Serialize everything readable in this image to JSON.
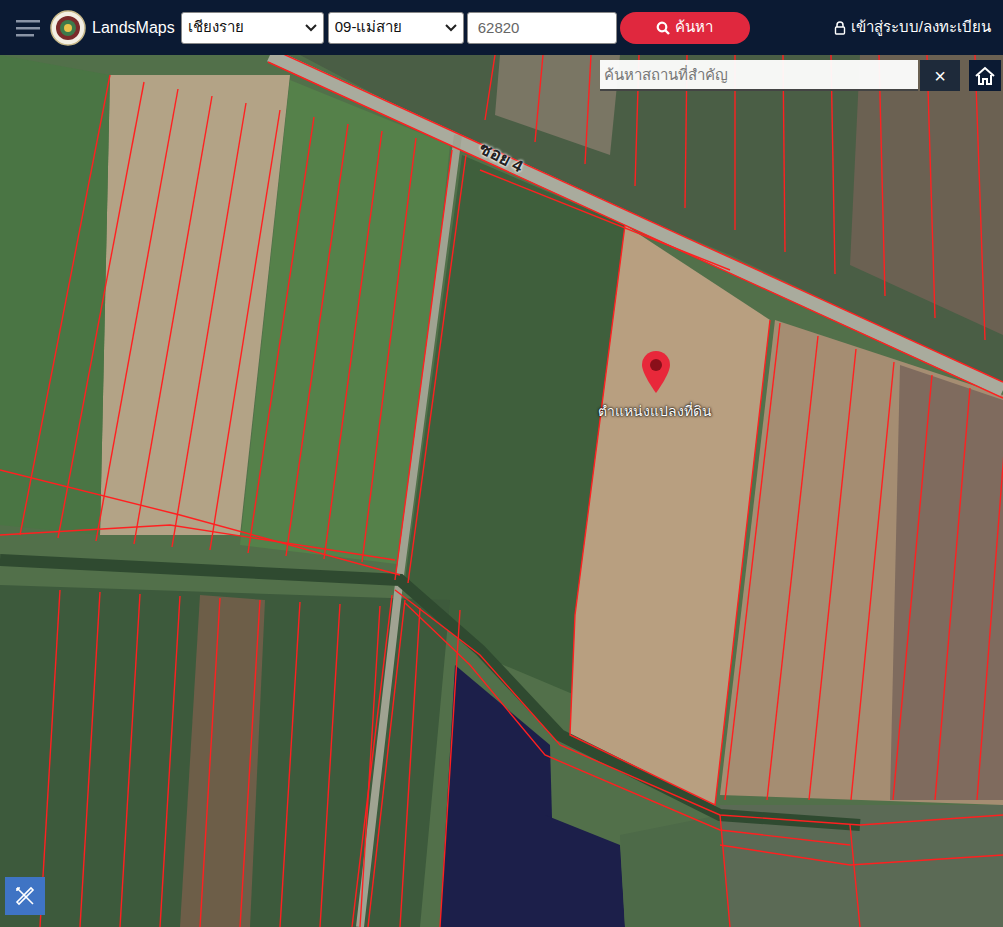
{
  "header": {
    "logo_text": "LandsMaps",
    "province": "เชียงราย",
    "district": "09-แม่สาย",
    "parcel_no": "62820",
    "search_button": "ค้นหา",
    "login": "เข้าสู่ระบบ/ลงทะเบียน"
  },
  "map": {
    "search_placeholder": "ค้นหาสถานที่สำคัญ",
    "close": "×",
    "road_label": "ซอย 4",
    "pin_label": "ตำแหน่งแปลงที่ดิน"
  }
}
